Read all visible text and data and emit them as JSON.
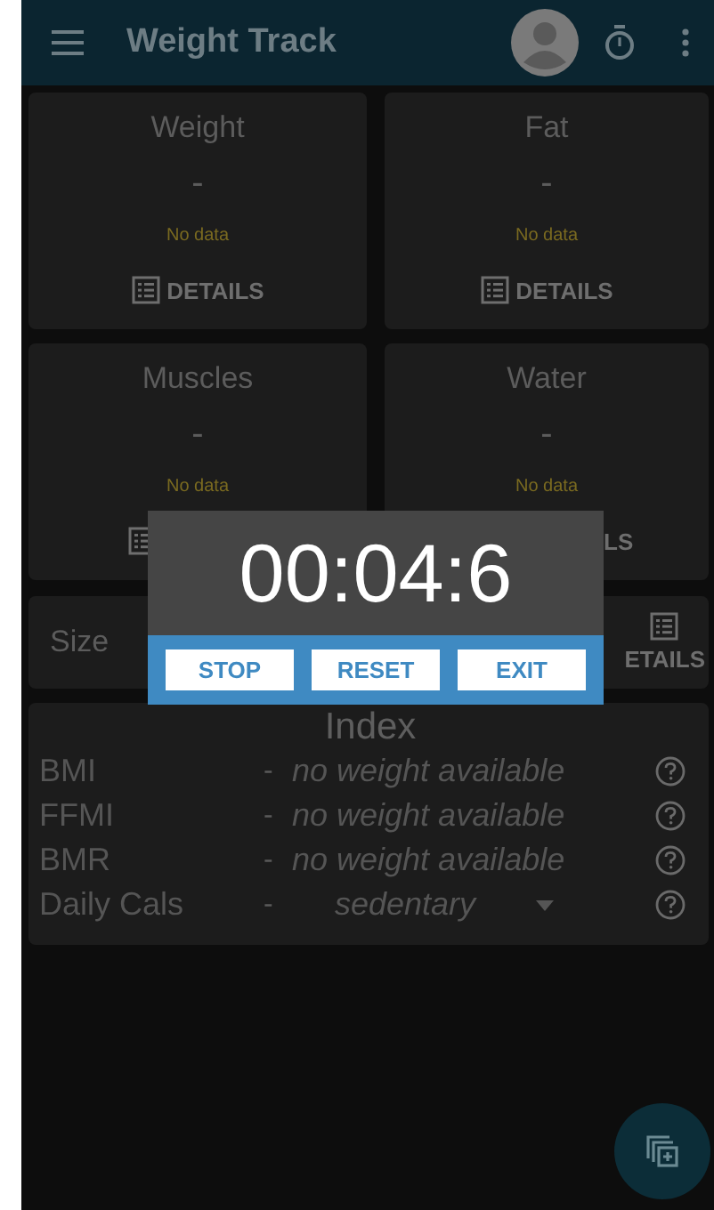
{
  "app_bar": {
    "title": "Weight Track"
  },
  "cards": [
    {
      "title": "Weight",
      "value": "-",
      "status": "No data",
      "details_icon": true,
      "details_label": "DETAILS"
    },
    {
      "title": "Fat",
      "value": "-",
      "status": "No data",
      "details_icon": true,
      "details_label": "DETAILS"
    },
    {
      "title": "Muscles",
      "value": "-",
      "status": "No data",
      "details_icon": true
    },
    {
      "title": "Water",
      "value": "-",
      "status": "No data",
      "details_icon": false,
      "details_label": "LS"
    }
  ],
  "size_card": {
    "title": "Size",
    "details_label": "ETAILS"
  },
  "index": {
    "title": "Index",
    "rows": [
      {
        "kind": "value",
        "label": "BMI",
        "dash": "-",
        "value": "no weight available"
      },
      {
        "kind": "value",
        "label": "FFMI",
        "dash": "-",
        "value": "no weight available"
      },
      {
        "kind": "value",
        "label": "BMR",
        "dash": "-",
        "value": "no weight available"
      },
      {
        "kind": "dropdown",
        "label": "Daily Cals",
        "dash": "-",
        "value": "sedentary"
      }
    ]
  },
  "timer_dialog": {
    "time": "00:04:6",
    "buttons": [
      "STOP",
      "RESET",
      "EXIT"
    ]
  }
}
